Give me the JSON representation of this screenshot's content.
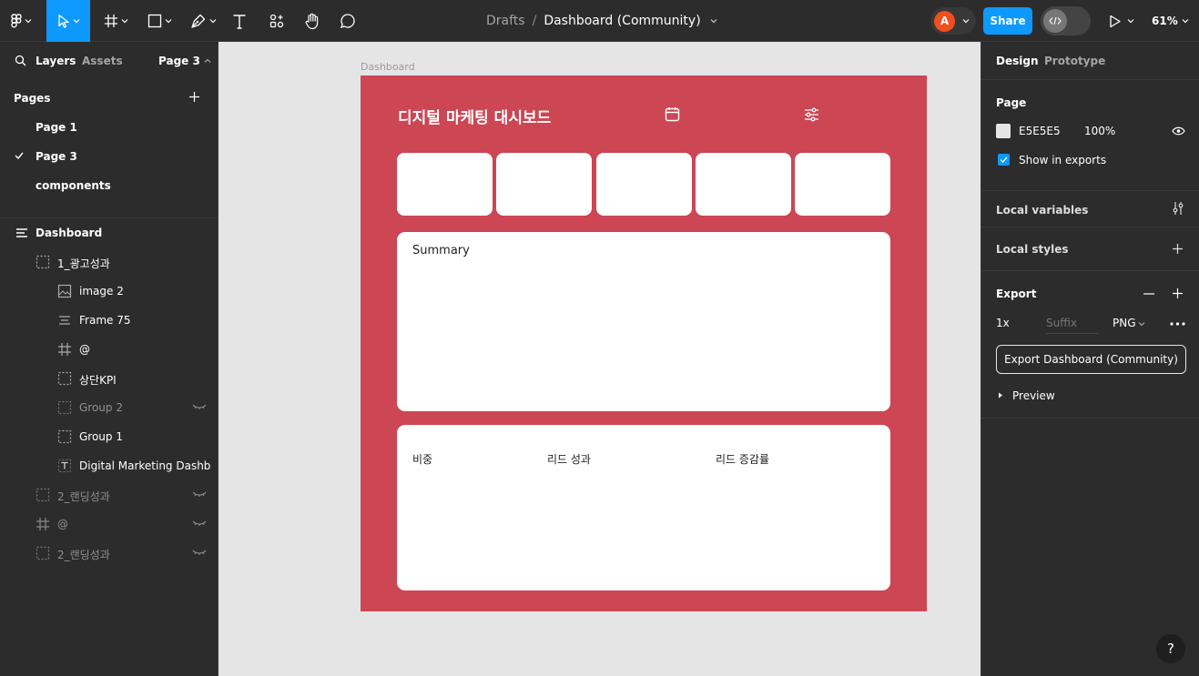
{
  "toolbar": {
    "breadcrumb_drafts": "Drafts",
    "breadcrumb_sep": "/",
    "file_name": "Dashboard (Community)",
    "avatar_initial": "A",
    "share_label": "Share",
    "zoom": "61%"
  },
  "left_panel": {
    "tab_layers": "Layers",
    "tab_assets": "Assets",
    "current_page": "Page 3",
    "pages_heading": "Pages",
    "pages": [
      {
        "label": "Page 1",
        "selected": false
      },
      {
        "label": "Page 3",
        "selected": true
      },
      {
        "label": "components",
        "selected": false
      }
    ],
    "layers": [
      {
        "label": "Dashboard",
        "icon": "frame-list-icon",
        "hidden": false
      },
      {
        "label": "1_광고성과",
        "icon": "group-icon",
        "hidden": false
      },
      {
        "label": "image 2",
        "icon": "image-icon",
        "hidden": false
      },
      {
        "label": "Frame 75",
        "icon": "frame-list-icon",
        "hidden": false
      },
      {
        "label": "@",
        "icon": "frame-icon",
        "hidden": false
      },
      {
        "label": "상단KPI",
        "icon": "group-icon",
        "hidden": false
      },
      {
        "label": "Group 2",
        "icon": "group-icon",
        "hidden": true
      },
      {
        "label": "Group 1",
        "icon": "group-icon",
        "hidden": false
      },
      {
        "label": "Digital Marketing Dashbo...",
        "icon": "text-icon",
        "hidden": false
      },
      {
        "label": "2_랜딩성과",
        "icon": "group-icon",
        "hidden": true
      },
      {
        "label": "@",
        "icon": "frame-icon",
        "hidden": true
      },
      {
        "label": "2_랜딩성과",
        "icon": "group-icon",
        "hidden": true
      }
    ]
  },
  "canvas": {
    "frame_label": "Dashboard",
    "dashboard_title": "디지털 마케팅 대시보드",
    "summary_label": "Summary",
    "bottom_labels": [
      "비중",
      "리드 성과",
      "리드 증감률"
    ],
    "frame_color": "#cc4654"
  },
  "right_panel": {
    "tab_design": "Design",
    "tab_prototype": "Prototype",
    "page_heading": "Page",
    "page_color": "E5E5E5",
    "page_opacity": "100%",
    "show_in_exports": "Show in exports",
    "local_variables": "Local variables",
    "local_styles": "Local styles",
    "export_heading": "Export",
    "export_scale": "1x",
    "export_suffix_placeholder": "Suffix",
    "export_format": "PNG",
    "export_button": "Export Dashboard (Community)",
    "preview": "Preview"
  },
  "help_label": "?"
}
